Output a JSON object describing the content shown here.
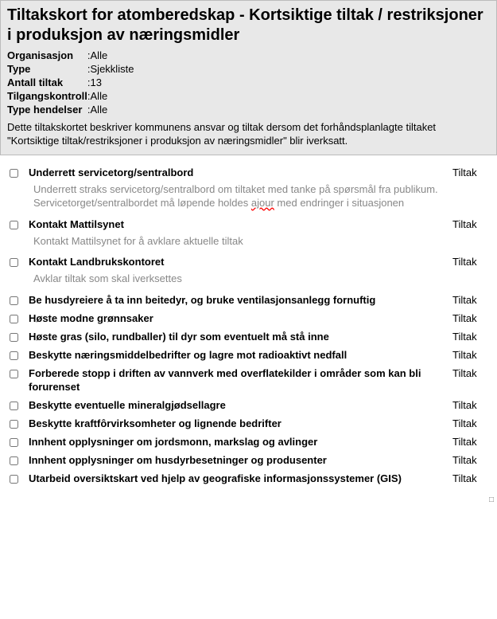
{
  "header": {
    "title": "Tiltakskort for atomberedskap - Kortsiktige tiltak / restriksjoner i produksjon av næringsmidler",
    "meta": [
      {
        "label": "Organisasjon",
        "value": "Alle"
      },
      {
        "label": "Type",
        "value": "Sjekkliste"
      },
      {
        "label": "Antall tiltak",
        "value": "13"
      },
      {
        "label": "Tilgangskontroll",
        "value": "Alle"
      },
      {
        "label": "Type hendelser",
        "value": "Alle"
      }
    ],
    "description": "Dette tiltakskortet beskriver kommunens ansvar og tiltak dersom det forhåndsplanlagte tiltaket \"Kortsiktige tiltak/restriksjoner i produksjon av næringsmidler\" blir iverksatt."
  },
  "type_label": "Tiltak",
  "items": [
    {
      "title": "Underrett servicetorg/sentralbord",
      "description_parts": [
        "Underrett straks servicetorg/sentralbord om tiltaket med tanke på spørsmål fra publikum. Servicetorget/sentralbordet må løpende holdes ",
        "ajour",
        " med endringer i situasjonen"
      ],
      "has_wavy": true
    },
    {
      "title": "Kontakt Mattilsynet",
      "description": "Kontakt Mattilsynet for å avklare aktuelle tiltak"
    },
    {
      "title": "Kontakt Landbrukskontoret",
      "description": "Avklar tiltak som skal iverksettes"
    },
    {
      "title": "Be husdyreiere å ta inn beitedyr, og bruke ventilasjonsanlegg fornuftig"
    },
    {
      "title": "Høste modne grønnsaker"
    },
    {
      "title": "Høste gras (silo, rundballer) til dyr som eventuelt må stå inne"
    },
    {
      "title": "Beskytte næringsmiddelbedrifter og lagre mot radioaktivt nedfall"
    },
    {
      "title": "Forberede stopp i driften av vannverk med overflatekilder i områder som kan bli forurenset"
    },
    {
      "title": "Beskytte eventuelle mineralgjødsellagre"
    },
    {
      "title": "Beskytte kraftfôrvirksomheter og lignende bedrifter"
    },
    {
      "title": "Innhent opplysninger om jordsmonn, markslag og avlinger"
    },
    {
      "title": "Innhent opplysninger om husdyrbesetninger og produsenter"
    },
    {
      "title": "Utarbeid oversiktskart ved hjelp av geografiske informasjonssystemer (GIS)"
    }
  ]
}
